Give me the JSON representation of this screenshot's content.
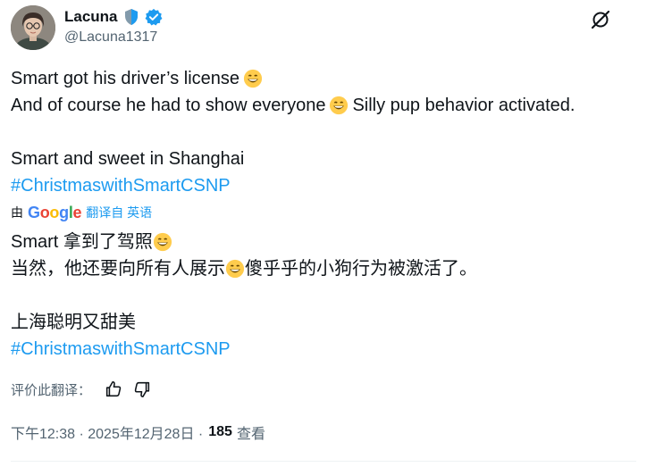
{
  "user": {
    "display_name": "Lacuna",
    "handle": "@Lacuna1317"
  },
  "post": {
    "line1": "Smart got his driver’s license",
    "line2a": "And of course he had to show everyone",
    "line2b": "Silly pup behavior activated.",
    "line3": "Smart and sweet in Shanghai",
    "hashtag": "#ChristmaswithSmartCSNP"
  },
  "translation": {
    "by_prefix": "由",
    "provider": "Google",
    "translated_from": "翻译自 英语",
    "line1": "Smart 拿到了驾照",
    "line2a": "当然，他还要向所有人展示",
    "line2b": "傻乎乎的小狗行为被激活了。",
    "line3": "上海聪明又甜美",
    "hashtag": "#ChristmaswithSmartCSNP"
  },
  "rate": {
    "label": "评价此翻译："
  },
  "meta": {
    "timestamp": "下午12:38 · 2025年12月28日 ·",
    "views_count": "185",
    "views_label": "查看"
  },
  "colors": {
    "link": "#1d9bf0",
    "text": "#0f1419",
    "muted": "#536471"
  }
}
